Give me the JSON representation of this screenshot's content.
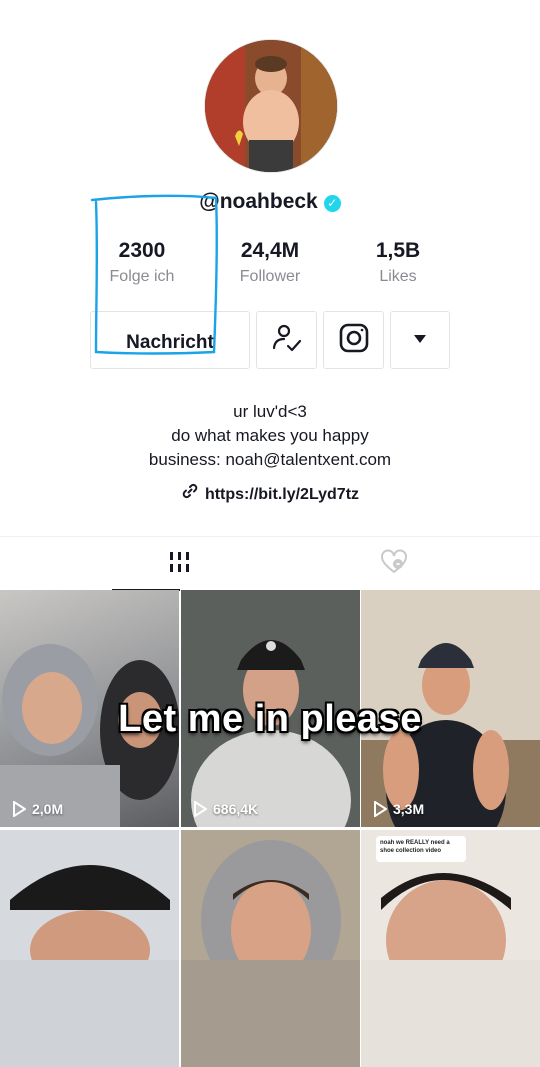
{
  "profile": {
    "username": "@noahbeck",
    "verified_icon": "verified-badge-icon"
  },
  "stats": [
    {
      "value": "2300",
      "label": "Folge ich"
    },
    {
      "value": "24,4M",
      "label": "Follower"
    },
    {
      "value": "1,5B",
      "label": "Likes"
    }
  ],
  "actions": {
    "message_label": "Nachricht",
    "follow_icon": "user-check-icon",
    "instagram_icon": "instagram-icon",
    "more_icon": "caret-down-icon"
  },
  "bio": {
    "line1": "ur luv'd<3",
    "line2": "do what makes you happy",
    "line3": "business: noah@talentxent.com"
  },
  "link": {
    "text": "https://bit.ly/2Lyd7tz",
    "icon": "link-icon"
  },
  "tabs": {
    "videos_icon": "grid-icon",
    "liked_icon": "heart-hidden-icon"
  },
  "videos": [
    {
      "views": "2,0M"
    },
    {
      "views": "686,4K"
    },
    {
      "views": "3,3M"
    },
    {
      "views": ""
    },
    {
      "views": ""
    },
    {
      "views": ""
    }
  ],
  "overlay": {
    "text": "Let me in please"
  },
  "caption_card": {
    "line1": "noah we REALLY need a",
    "line2": "shoe collection video"
  },
  "colors": {
    "verified": "#20d5ec",
    "annotation": "#1aa3e8",
    "text": "#161823",
    "secondary": "#8a8b91"
  }
}
